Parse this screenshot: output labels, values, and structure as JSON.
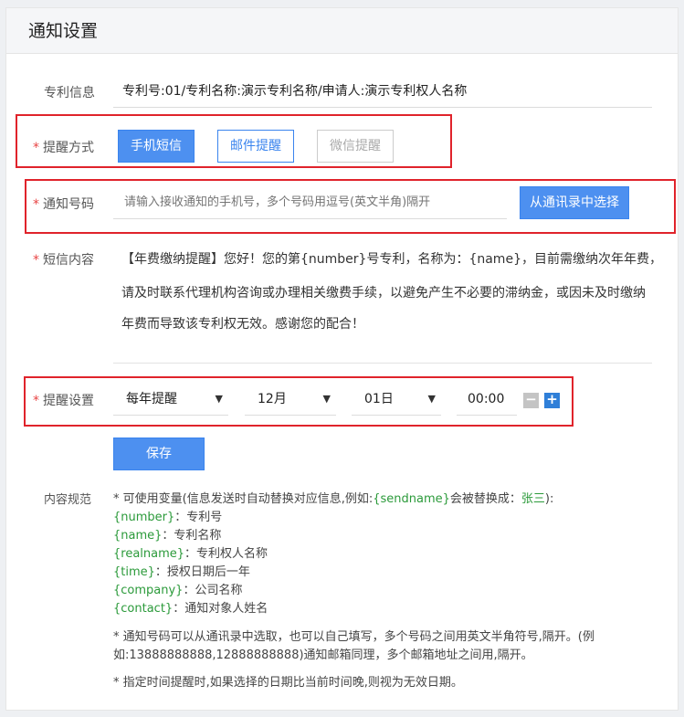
{
  "header": {
    "title": "通知设置"
  },
  "patent": {
    "label": "专利信息",
    "value": "专利号:01/专利名称:演示专利名称/申请人:演示专利权人名称"
  },
  "method": {
    "label": "提醒方式",
    "options": [
      "手机短信",
      "邮件提醒",
      "微信提醒"
    ]
  },
  "number": {
    "label": "通知号码",
    "placeholder": "请输入接收通知的手机号，多个号码用逗号(英文半角)隔开",
    "pick_button": "从通讯录中选择"
  },
  "sms": {
    "label": "短信内容",
    "lines": [
      "【年费缴纳提醒】您好！您的第{number}号专利，名称为：{name}，目前需缴纳次年年费，",
      "请及时联系代理机构咨询或办理相关缴费手续，以避免产生不必要的滞纳金，或因未及时缴纳",
      "年费而导致该专利权无效。感谢您的配合！"
    ]
  },
  "schedule": {
    "label": "提醒设置",
    "frequency": "每年提醒",
    "month": "12月",
    "day": "01日",
    "time": "00:00",
    "minus": "−",
    "plus": "+"
  },
  "save_label": "保存",
  "spec": {
    "label": "内容规范",
    "intro_prefix": "* 可使用变量(信息发送时自动替换对应信息,例如:",
    "intro_var": "{sendname}",
    "intro_mid": "会被替换成：",
    "intro_value": "张三",
    "intro_suffix": "):",
    "vars": [
      {
        "key": "{number}",
        "desc": "：专利号"
      },
      {
        "key": "{name}",
        "desc": "：专利名称"
      },
      {
        "key": "{realname}",
        "desc": "：专利权人名称"
      },
      {
        "key": "{time}",
        "desc": "：授权日期后一年"
      },
      {
        "key": "{company}",
        "desc": "：公司名称"
      },
      {
        "key": "{contact}",
        "desc": "：通知对象人姓名"
      }
    ],
    "note1_line1": "* 通知号码可以从通讯录中选取，也可以自己填写，多个号码之间用英文半角符号,隔开。(例",
    "note1_line2": "如:13888888888,12888888888)通知邮箱同理，多个邮箱地址之间用,隔开。",
    "note2": "* 指定时间提醒时,如果选择的日期比当前时间晚,则视为无效日期。"
  },
  "colors": {
    "primary": "#4d90f0",
    "highlight": "#e0232b",
    "variable": "#2b9a3a"
  }
}
